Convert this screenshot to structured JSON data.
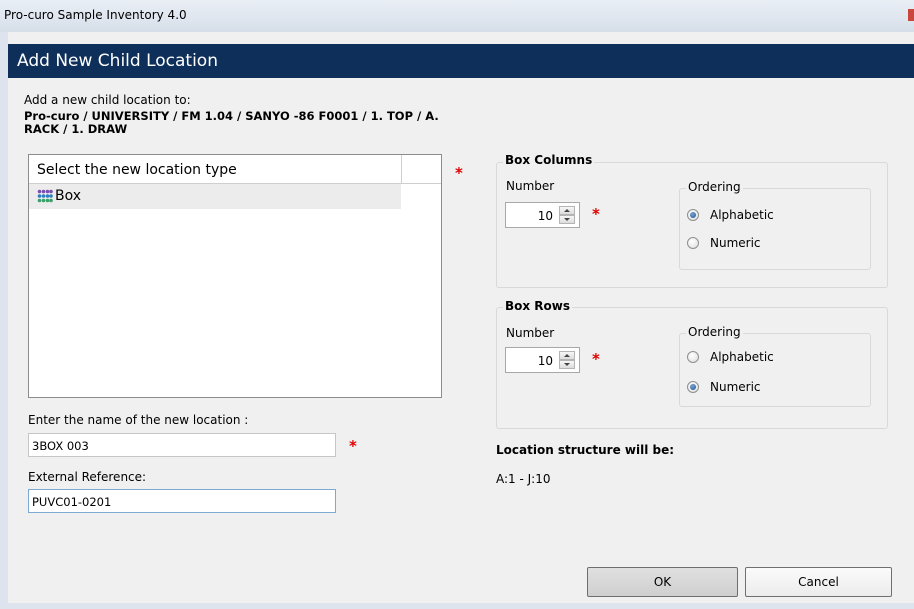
{
  "window": {
    "title": "Pro-curo Sample Inventory 4.0"
  },
  "dialog": {
    "header": "Add New Child Location",
    "intro_label": "Add a new child location to:",
    "parent_path": "Pro-curo / UNIVERSITY / FM 1.04 / SANYO -86 F0001 / 1. TOP / A. RACK / 1. DRAW"
  },
  "location_type": {
    "header": "Select the new location type",
    "items": [
      {
        "label": "Box",
        "icon": "box-grid-icon"
      }
    ]
  },
  "name_field": {
    "label": "Enter the name of the new location :",
    "value": "3BOX 003"
  },
  "external_ref": {
    "label": "External Reference:",
    "value": "PUVC01-0201"
  },
  "box_columns": {
    "title": "Box Columns",
    "number_label": "Number",
    "number_value": "10",
    "ordering_title": "Ordering",
    "options": [
      "Alphabetic",
      "Numeric"
    ],
    "selected": "Alphabetic"
  },
  "box_rows": {
    "title": "Box Rows",
    "number_label": "Number",
    "number_value": "10",
    "ordering_title": "Ordering",
    "options": [
      "Alphabetic",
      "Numeric"
    ],
    "selected": "Numeric"
  },
  "structure": {
    "label": "Location structure will be:",
    "value": "A:1 - J:10"
  },
  "required_marker": "*",
  "buttons": {
    "ok": "OK",
    "cancel": "Cancel"
  },
  "colors": {
    "header_bg": "#0e2f5a",
    "required": "#e00000"
  }
}
